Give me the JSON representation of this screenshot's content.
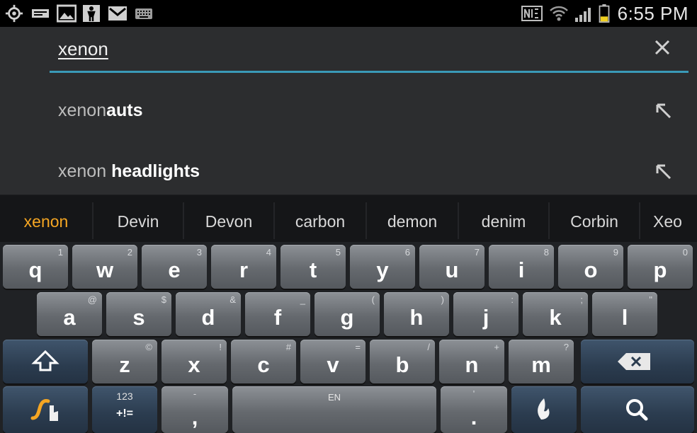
{
  "status_bar": {
    "time": "6:55 PM",
    "left_icons": [
      "location-icon",
      "message-icon",
      "gallery-icon",
      "usb-debug-icon",
      "email-icon",
      "keyboard-icon"
    ],
    "right_icons": [
      "nfc-icon",
      "wifi-icon",
      "signal-icon",
      "battery-icon"
    ],
    "battery_level": 0.3
  },
  "search": {
    "query": "xenon",
    "clear_icon": "close-icon"
  },
  "suggestions": [
    {
      "prefix": "xenon",
      "rest": "auts",
      "icon": "insert-arrow-icon"
    },
    {
      "prefix": "xenon ",
      "rest": "headlights",
      "icon": "insert-arrow-icon"
    }
  ],
  "candidates": [
    "xenon",
    "Devin",
    "Devon",
    "carbon",
    "demon",
    "denim",
    "Corbin",
    "Xeo"
  ],
  "keyboard": {
    "row1": [
      {
        "k": "q",
        "s": "1"
      },
      {
        "k": "w",
        "s": "2"
      },
      {
        "k": "e",
        "s": "3"
      },
      {
        "k": "r",
        "s": "4"
      },
      {
        "k": "t",
        "s": "5"
      },
      {
        "k": "y",
        "s": "6"
      },
      {
        "k": "u",
        "s": "7"
      },
      {
        "k": "i",
        "s": "8"
      },
      {
        "k": "o",
        "s": "9"
      },
      {
        "k": "p",
        "s": "0"
      }
    ],
    "row2": [
      {
        "k": "a",
        "s": "@"
      },
      {
        "k": "s",
        "s": "$"
      },
      {
        "k": "d",
        "s": "&"
      },
      {
        "k": "f",
        "s": "_"
      },
      {
        "k": "g",
        "s": "("
      },
      {
        "k": "h",
        "s": ")"
      },
      {
        "k": "j",
        "s": ":"
      },
      {
        "k": "k",
        "s": ";"
      },
      {
        "k": "l",
        "s": "\""
      }
    ],
    "row3": [
      {
        "k": "z",
        "s": "©"
      },
      {
        "k": "x",
        "s": "!"
      },
      {
        "k": "c",
        "s": "#"
      },
      {
        "k": "v",
        "s": "="
      },
      {
        "k": "b",
        "s": "/"
      },
      {
        "k": "n",
        "s": "+"
      },
      {
        "k": "m",
        "s": "?"
      }
    ],
    "sym_key_top": "123",
    "sym_key_bottom": "+!=",
    "comma_main": ",",
    "comma_sub": "-",
    "space_label": "EN",
    "period_main": ".",
    "period_sub": "'",
    "shift_icon": "shift-icon",
    "backspace_icon": "backspace-icon",
    "swype_icon": "swype-icon",
    "dragon_icon": "dragon-voice-icon",
    "search_icon": "search-icon"
  }
}
